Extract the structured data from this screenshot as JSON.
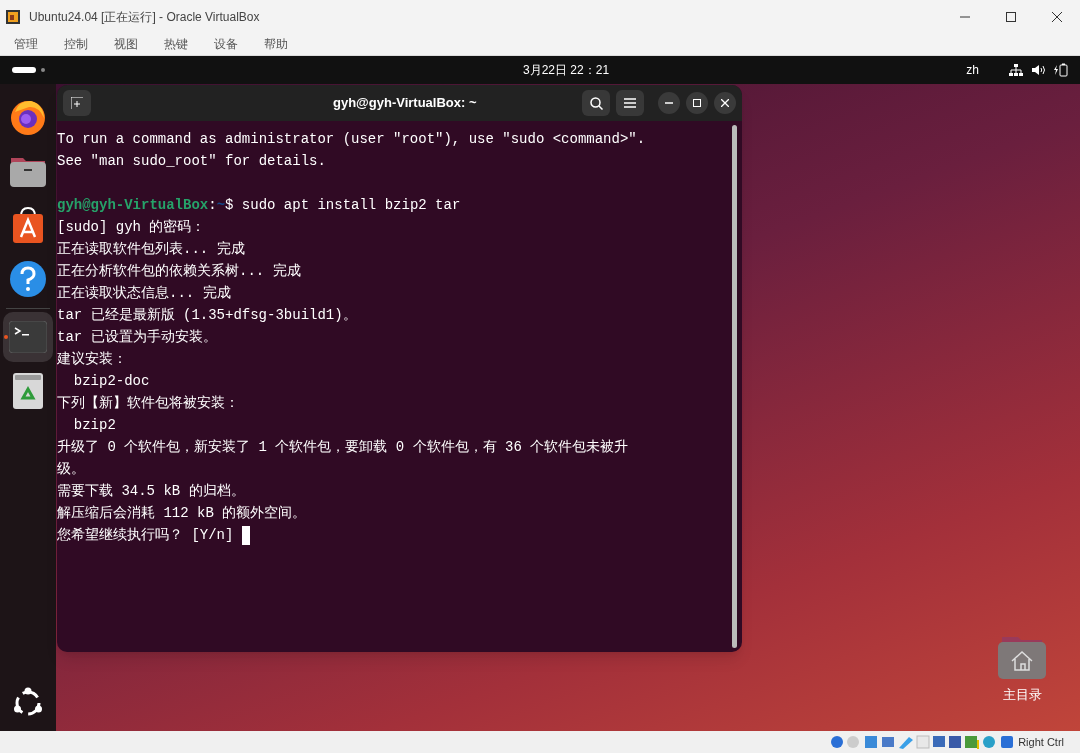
{
  "window": {
    "title": "Ubuntu24.04 [正在运行] - Oracle VirtualBox"
  },
  "menu": [
    "管理",
    "控制",
    "视图",
    "热键",
    "设备",
    "帮助"
  ],
  "top_bar": {
    "clock": "3月22日 22：21",
    "input_method": "zh"
  },
  "dock": [
    {
      "kind": "firefox",
      "active": false
    },
    {
      "kind": "files",
      "active": false
    },
    {
      "kind": "appcenter",
      "active": false
    },
    {
      "kind": "help",
      "active": false
    },
    {
      "kind": "terminal",
      "active": true
    },
    {
      "kind": "trash",
      "active": false
    }
  ],
  "terminal": {
    "title": "gyh@gyh-VirtualBox: ~",
    "lines": [
      {
        "kind": "output",
        "text": "To run a command as administrator (user \"root\"), use \"sudo <command>\"."
      },
      {
        "kind": "output",
        "text": "See \"man sudo_root\" for details."
      },
      {
        "kind": "blank"
      },
      {
        "kind": "prompt",
        "user_host": "gyh@gyh-VirtualBox",
        "separator": ":",
        "path": "~",
        "command": "$ sudo apt install bzip2 tar"
      },
      {
        "kind": "output",
        "text": "[sudo] gyh 的密码："
      },
      {
        "kind": "output",
        "text": "正在读取软件包列表... 完成"
      },
      {
        "kind": "output",
        "text": "正在分析软件包的依赖关系树... 完成"
      },
      {
        "kind": "output",
        "text": "正在读取状态信息... 完成"
      },
      {
        "kind": "output",
        "text": "tar 已经是最新版 (1.35+dfsg-3build1)。"
      },
      {
        "kind": "output",
        "text": "tar 已设置为手动安装。"
      },
      {
        "kind": "output",
        "text": "建议安装："
      },
      {
        "kind": "output",
        "text": "  bzip2-doc"
      },
      {
        "kind": "output",
        "text": "下列【新】软件包将被安装："
      },
      {
        "kind": "output",
        "text": "  bzip2"
      },
      {
        "kind": "output",
        "text": "升级了 0 个软件包，新安装了 1 个软件包，要卸载 0 个软件包，有 36 个软件包未被升"
      },
      {
        "kind": "output",
        "text": "级。"
      },
      {
        "kind": "output",
        "text": "需要下载 34.5 kB 的归档。"
      },
      {
        "kind": "output",
        "text": "解压缩后会消耗 112 kB 的额外空间。"
      },
      {
        "kind": "output",
        "text": "您希望继续执行吗？ [Y/n] ",
        "cursor": true
      }
    ]
  },
  "desktop_icons": [
    {
      "label": "主目录"
    }
  ],
  "status_bar": {
    "host_key": "Right Ctrl"
  }
}
